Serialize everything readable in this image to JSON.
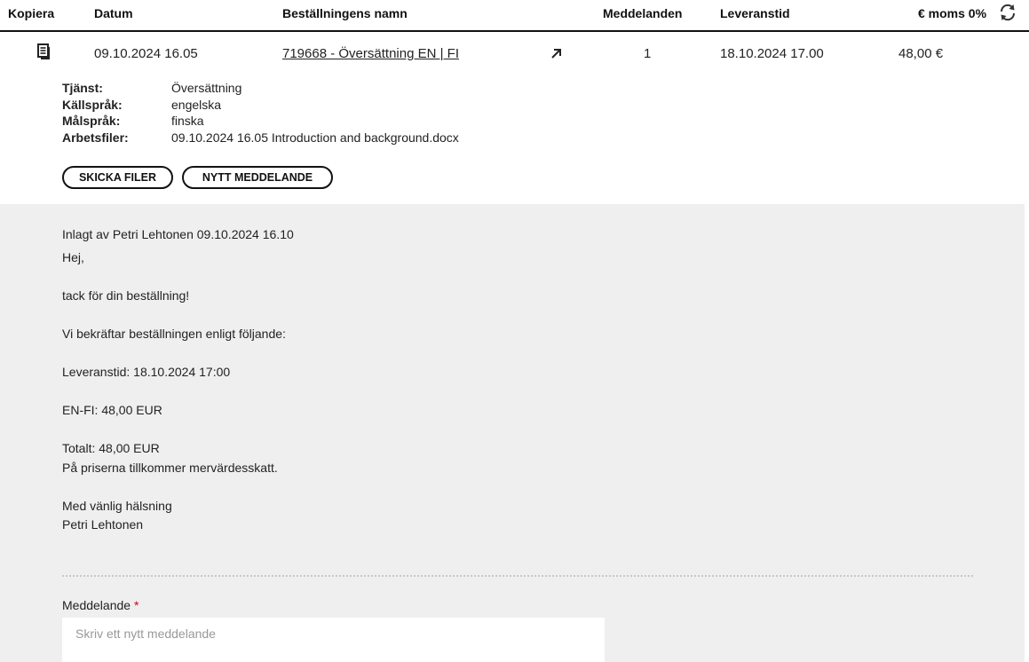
{
  "columns": {
    "kopiera": "Kopiera",
    "datum": "Datum",
    "namn": "Beställningens namn",
    "meddelanden": "Meddelanden",
    "leveranstid": "Leveranstid",
    "moms": "€ moms 0%"
  },
  "icons": {
    "refresh": "refresh-icon",
    "copy": "copy-document-icon",
    "open": "arrow-up-right-icon"
  },
  "order": {
    "datum": "09.10.2024 16.05",
    "namn": "719668 - Översättning EN | FI",
    "meddelanden": "1",
    "leveranstid": "18.10.2024 17.00",
    "pris": "48,00 €",
    "details": [
      {
        "label": "Tjänst:",
        "value": "Översättning"
      },
      {
        "label": "Källspråk:",
        "value": "engelska"
      },
      {
        "label": "Målspråk:",
        "value": "finska"
      },
      {
        "label": "Arbetsfiler:",
        "value": "09.10.2024 16.05 Introduction and background.docx"
      }
    ]
  },
  "buttons": {
    "skicka_filer": "SKICKA FILER",
    "nytt_meddelande": "NYTT MEDDELANDE"
  },
  "message": {
    "author": "Inlagt av Petri Lehtonen 09.10.2024 16.10",
    "lines": [
      "Hej,",
      "tack för din beställning!",
      "Vi bekräftar beställningen enligt följande:",
      "Leveranstid: 18.10.2024 17:00",
      "EN-FI: 48,00 EUR",
      "Totalt: 48,00 EUR",
      "På priserna tillkommer mervärdesskatt.",
      "Med vänlig hälsning",
      "Petri Lehtonen"
    ]
  },
  "form": {
    "label": "Meddelande",
    "required_mark": "*",
    "placeholder": "Skriv ett nytt meddelande"
  },
  "colors": {
    "panel_background": "#efefef",
    "required": "#d0021b"
  }
}
